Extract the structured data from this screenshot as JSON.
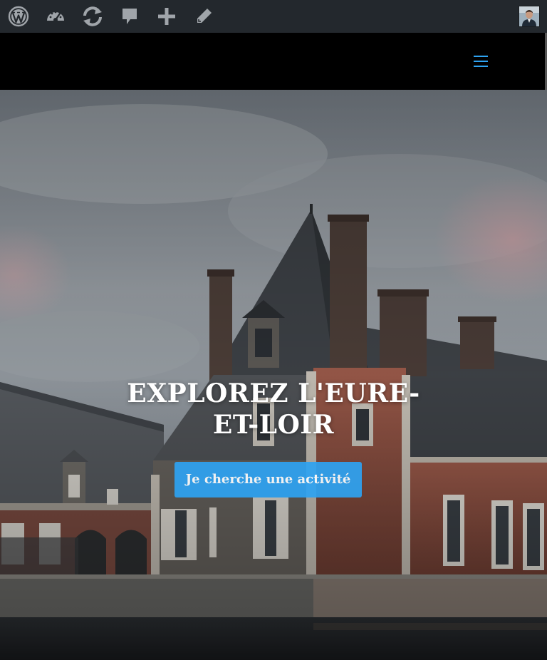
{
  "adminbar": {
    "items": [
      {
        "icon": "wordpress-logo-icon"
      },
      {
        "icon": "dashboard-gauge-icon"
      },
      {
        "icon": "updates-refresh-icon"
      },
      {
        "icon": "comments-bubble-icon"
      },
      {
        "icon": "new-content-plus-icon"
      },
      {
        "icon": "edit-pencil-icon"
      }
    ],
    "avatar_icon": "user-avatar"
  },
  "header": {
    "menu_icon": "hamburger-menu-icon",
    "menu_color": "#2ea3f2"
  },
  "hero": {
    "title": "EXPLOREZ L'EURE-ET-LOIR",
    "cta_label": "Je cherche une activité",
    "cta_color": "#2ea3f2"
  },
  "colors": {
    "adminbar_bg": "#23282d",
    "adminbar_icon": "#a0a5aa",
    "header_bg": "#000000"
  }
}
